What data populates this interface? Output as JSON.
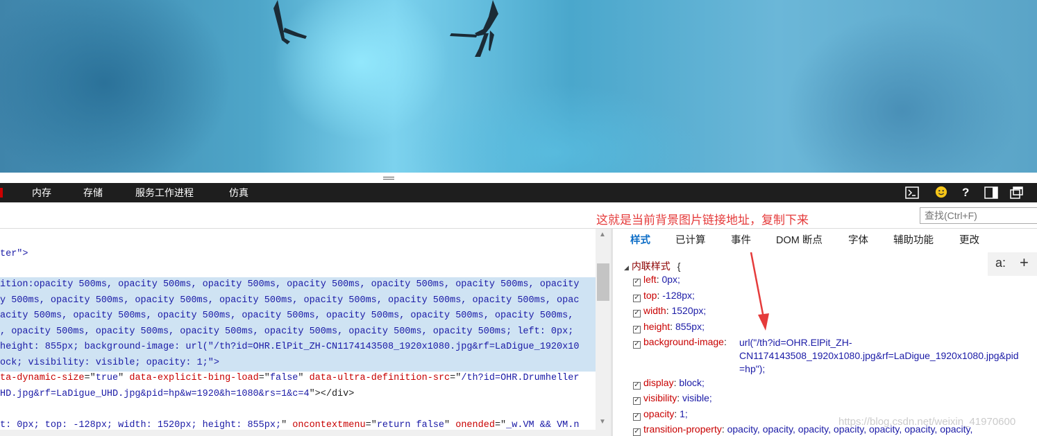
{
  "devtools_tabs": [
    "内存",
    "存储",
    "服务工作进程",
    "仿真"
  ],
  "toolbar_icons": [
    "console-icon",
    "smiley-feedback-icon",
    "help-icon",
    "dock-icon",
    "undock-icon"
  ],
  "annotation": "这就是当前背景图片链接地址，复制下来",
  "find": {
    "placeholder": "查找(Ctrl+F)"
  },
  "dom_lines": {
    "l0": "ter\">",
    "l1": "ition:opacity 500ms, opacity 500ms, opacity 500ms, opacity 500ms, opacity 500ms, opacity 500ms, opacity",
    "l2": "y 500ms, opacity 500ms, opacity 500ms, opacity 500ms, opacity 500ms, opacity 500ms, opacity 500ms, opac",
    "l3": "acity 500ms, opacity 500ms, opacity 500ms, opacity 500ms, opacity 500ms, opacity 500ms, opacity 500ms,",
    "l4": ", opacity 500ms, opacity 500ms, opacity 500ms, opacity 500ms, opacity 500ms, opacity 500ms; left: 0px;",
    "l5": "height: 855px; background-image: url(\"/th?id=OHR.ElPit_ZH-CN1174143508_1920x1080.jpg&rf=LaDigue_1920x10",
    "l6": "ock; visibility: visible; opacity: 1;\">",
    "l7a": "ta-dynamic-size",
    "l7b": "=\"",
    "l7c": "true",
    "l7d": "\" ",
    "l7e": "data-explicit-bing-load",
    "l7f": "false",
    "l7g": "data-ultra-definition-src",
    "l7h": "/th?id=OHR.Drumheller",
    "l8a": "HD.jpg&rf=LaDigue_UHD.jpg&pid=hp&w=1920&h=1080&rs=1&c=4",
    "l8b": "\"></div>",
    "l9a": "t: 0px; top: -128px; width: 1520px; height: 855px;",
    "l9b": "oncontextmenu",
    "l9c": "return false",
    "l9d": "onended",
    "l9e": "_w.VM && VM.n"
  },
  "style_tabs": [
    "样式",
    "已计算",
    "事件",
    "DOM 断点",
    "字体",
    "辅助功能",
    "更改"
  ],
  "styles_toolbar": {
    "pseudo_label": "a:",
    "add_label": "+"
  },
  "inline_rule": "内联样式",
  "inline_rule_brace": "{",
  "declarations": [
    {
      "prop": "left",
      "value": "0px;"
    },
    {
      "prop": "top",
      "value": "-128px;"
    },
    {
      "prop": "width",
      "value": "1520px;"
    },
    {
      "prop": "height",
      "value": "855px;"
    },
    {
      "prop": "background-image",
      "value": "url(\"/th?id=OHR.ElPit_ZH-"
    },
    {
      "prop": "display",
      "value": "block;"
    },
    {
      "prop": "visibility",
      "value": "visible;"
    },
    {
      "prop": "opacity",
      "value": "1;"
    },
    {
      "prop": "transition-property",
      "value": "opacity, opacity, opacity, opacity, opacity, opacity, opacity,"
    }
  ],
  "bg_value_line2": "CN1174143508_1920x1080.jpg&rf=LaDigue_1920x1080.jpg&pid",
  "bg_value_line3": "=hp\");",
  "watermark": "https://blog.csdn.net/weixin_41970600",
  "colors": {
    "annotation": "#e53b3b",
    "active_tab": "#0e6ec7",
    "selection": "#cfe3f3",
    "devtools_bar": "#1e1e1e"
  }
}
